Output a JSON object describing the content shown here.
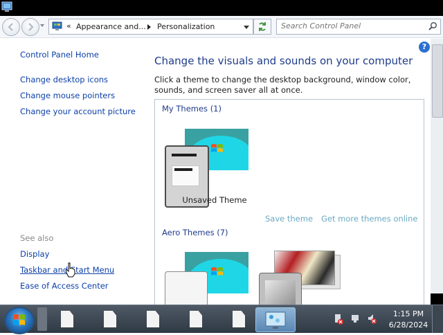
{
  "navigation": {
    "breadcrumb_overflow": "«",
    "breadcrumbs": [
      "Appearance and...",
      "Personalization"
    ],
    "search_placeholder": "Search Control Panel"
  },
  "left_pane": {
    "links": [
      "Control Panel Home",
      "Change desktop icons",
      "Change mouse pointers",
      "Change your account picture"
    ],
    "see_also_heading": "See also",
    "see_also_links": [
      "Display",
      "Taskbar and Start Menu",
      "Ease of Access Center"
    ]
  },
  "main": {
    "title": "Change the visuals and sounds on your computer",
    "description": "Click a theme to change the desktop background, window color, sounds, and screen saver all at once.",
    "help_icon": "?",
    "my_themes_heading": "My Themes (1)",
    "unsaved_theme_label": "Unsaved Theme",
    "save_theme_link": "Save theme",
    "more_themes_link": "Get more themes online",
    "aero_themes_heading": "Aero Themes (7)"
  },
  "taskbar": {
    "time": "1:15 PM",
    "date": "6/28/2024"
  },
  "colors": {
    "link": "#0b3fa8",
    "heading": "#1e3b8a",
    "inactive_link": "#6aa9c1",
    "theme_background": "#3aa1a2",
    "theme_splash": "#1fd6e6"
  }
}
